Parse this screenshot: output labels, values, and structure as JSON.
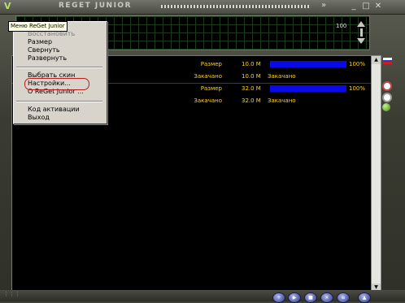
{
  "window": {
    "title": "REGET JUNIOR",
    "logo_glyph": "V",
    "ticker_chevron": "»",
    "min_glyph": "_",
    "max_glyph": "□",
    "close_glyph": "✕"
  },
  "graph": {
    "scale_label": "100"
  },
  "menu": {
    "tooltip": "Меню ReGet Junior",
    "items": [
      {
        "label": "Восстановить",
        "disabled": true
      },
      {
        "label": "Размер",
        "disabled": false
      },
      {
        "label": "Свернуть",
        "disabled": false
      },
      {
        "label": "Развернуть",
        "disabled": false
      },
      {
        "label": "Выбрать скин",
        "disabled": false
      },
      {
        "label": "Настройки...",
        "disabled": false
      },
      {
        "label": "О ReGet Junior ...",
        "disabled": false
      },
      {
        "label": "Код активации",
        "disabled": false
      },
      {
        "label": "Выход",
        "disabled": false
      }
    ]
  },
  "downloads": [
    {
      "size_label": "Размер",
      "size": "10.0 M",
      "progress_percent": 100,
      "percent": "100%",
      "done_label": "Закачано",
      "done": "10.0 M",
      "status": "Закачано"
    },
    {
      "size_label": "Размер",
      "size": "32.0 M",
      "progress_percent": 100,
      "percent": "100%",
      "done_label": "Закачано",
      "done": "32.0 M",
      "status": "Закачано"
    }
  ],
  "colors": {
    "accent_text": "#ffd21e",
    "progress": "#0a0ae6",
    "highlight_ring": "#b81e1e"
  },
  "icons": [
    "flag-ru-icon",
    "category-red-icon",
    "category-white-icon",
    "category-green-icon",
    "toolbar-add-icon"
  ]
}
